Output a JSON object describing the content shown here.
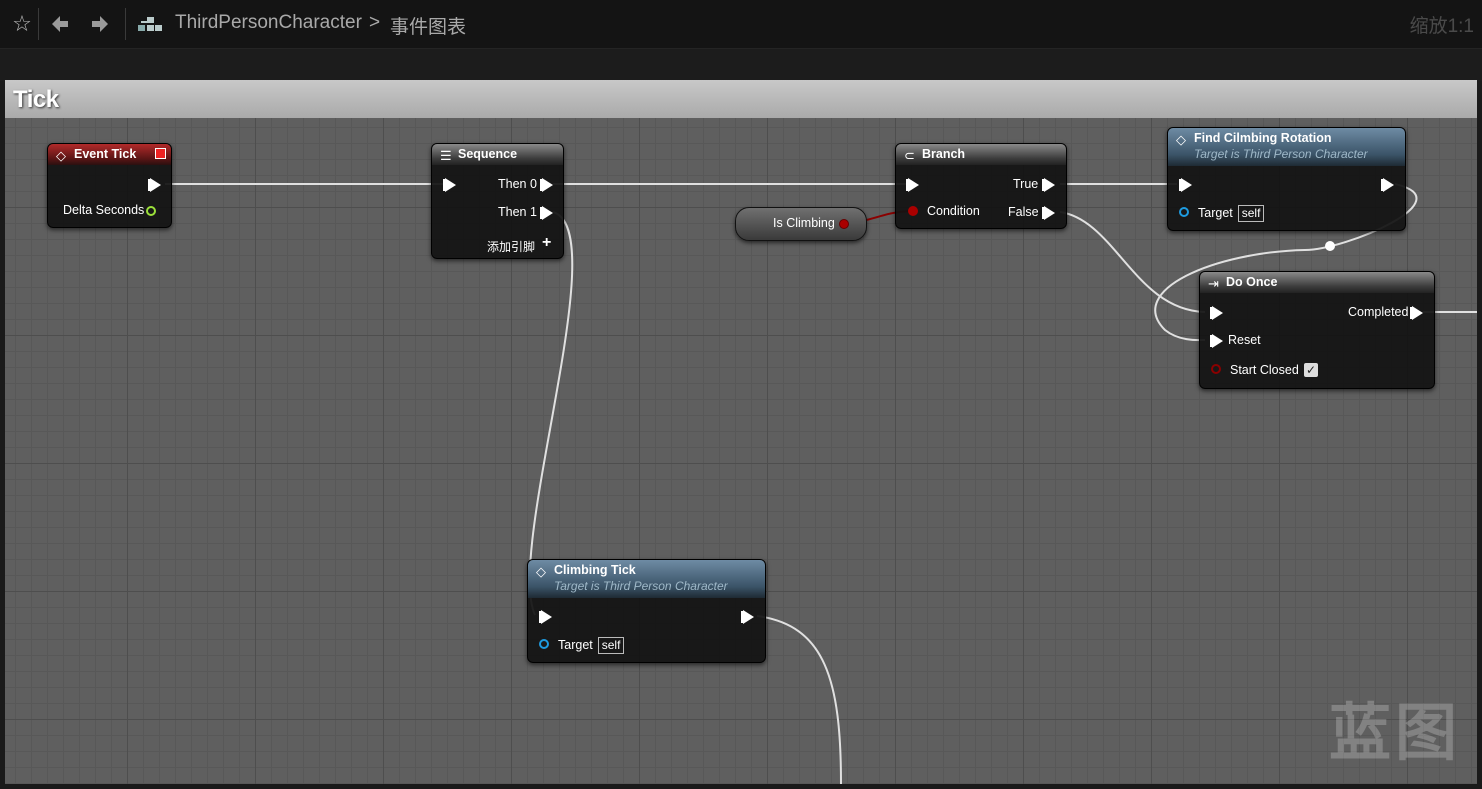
{
  "toolbar": {
    "breadcrumb_item1": "ThirdPersonCharacter",
    "breadcrumb_sep": ">",
    "breadcrumb_item2": "事件图表",
    "zoom": "缩放1:1"
  },
  "graph": {
    "title": "Tick",
    "watermark": "蓝图"
  },
  "nodes": {
    "event_tick": {
      "title": "Event Tick",
      "pin_delta": "Delta Seconds"
    },
    "sequence": {
      "title": "Sequence",
      "then0": "Then 0",
      "then1": "Then 1",
      "add_pin": "添加引脚"
    },
    "is_climbing": {
      "label": "Is Climbing"
    },
    "branch": {
      "title": "Branch",
      "condition": "Condition",
      "true_pin": "True",
      "false_pin": "False"
    },
    "find_rotation": {
      "title": "Find Cilmbing Rotation",
      "subtitle": "Target is Third Person Character",
      "target": "Target",
      "self": "self"
    },
    "do_once": {
      "title": "Do Once",
      "completed": "Completed",
      "reset": "Reset",
      "start_closed": "Start Closed"
    },
    "climbing_tick": {
      "title": "Climbing Tick",
      "subtitle": "Target is Third Person Character",
      "target": "Target",
      "self": "self"
    }
  },
  "icons": {
    "star": "star-icon",
    "back": "back-arrow-icon",
    "forward": "forward-arrow-icon",
    "graph": "graph-icon"
  },
  "colors": {
    "exec_wire": "#e0e0e0",
    "bool_wire": "#8b0000",
    "object_pin": "#1e9be0",
    "float_pin": "#9be03a",
    "event_header": "#b22a2a"
  }
}
